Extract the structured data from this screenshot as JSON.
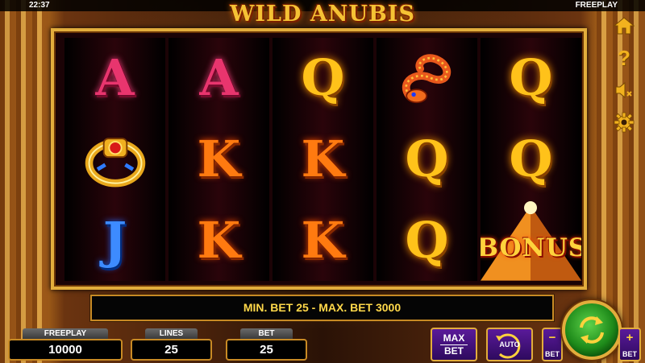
{
  "status_bar": {
    "clock": "22:37",
    "mode": "FREEPLAY"
  },
  "game": {
    "title": "WILD ANUBIS"
  },
  "reels": [
    [
      {
        "symbol": "A",
        "kind": "a"
      },
      {
        "symbol": "ring",
        "kind": "image"
      },
      {
        "symbol": "J",
        "kind": "j"
      }
    ],
    [
      {
        "symbol": "A",
        "kind": "a"
      },
      {
        "symbol": "K",
        "kind": "k"
      },
      {
        "symbol": "K",
        "kind": "k"
      }
    ],
    [
      {
        "symbol": "Q",
        "kind": "q"
      },
      {
        "symbol": "K",
        "kind": "k"
      },
      {
        "symbol": "K",
        "kind": "k"
      }
    ],
    [
      {
        "symbol": "snake",
        "kind": "image"
      },
      {
        "symbol": "Q",
        "kind": "q"
      },
      {
        "symbol": "Q",
        "kind": "q"
      }
    ],
    [
      {
        "symbol": "Q",
        "kind": "q"
      },
      {
        "symbol": "Q",
        "kind": "q"
      },
      {
        "symbol": "BONUS",
        "kind": "bonus"
      }
    ]
  ],
  "side_buttons": {
    "home_icon": "home-icon",
    "help_label": "?",
    "sound_icon": "speaker-muted-icon",
    "settings_icon": "gear-icon"
  },
  "message": "MIN. BET 25 - MAX. BET 3000",
  "panels": {
    "freeplay": {
      "label": "FREEPLAY",
      "value": "10000"
    },
    "lines": {
      "label": "LINES",
      "value": "25"
    },
    "bet": {
      "label": "BET",
      "value": "25"
    }
  },
  "controls": {
    "max_bet_line1": "MAX",
    "max_bet_line2": "BET",
    "auto_label": "AUTO",
    "bet_minus_sign": "−",
    "bet_minus_label": "BET",
    "bet_plus_sign": "+",
    "bet_plus_label": "BET",
    "spin_icon": "spin-arrows-icon"
  },
  "colors": {
    "gold": "#e2ad3c",
    "message_text": "#ffd84a",
    "spin_green": "#1e8a1a",
    "button_purple": "#5a1a9a"
  }
}
